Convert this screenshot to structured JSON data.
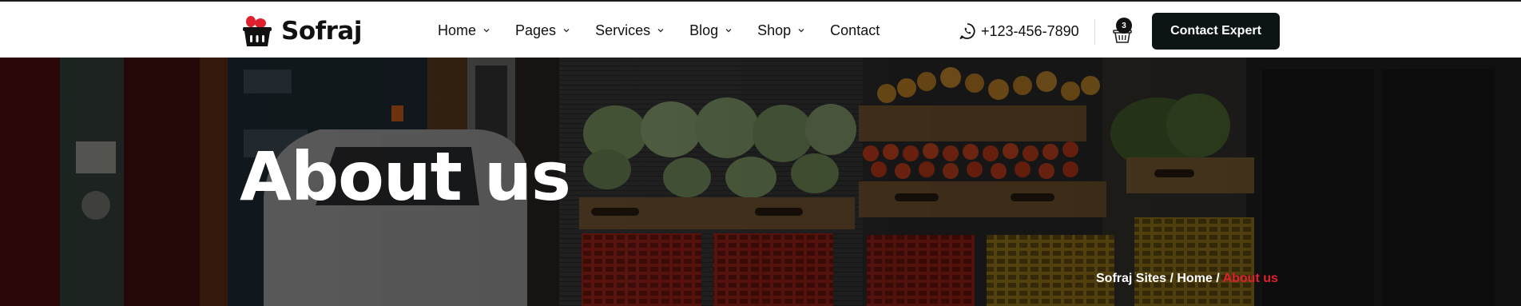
{
  "brand": {
    "name": "Sofraj",
    "accent": "#e0202f",
    "dark": "#0d1416"
  },
  "nav": {
    "items": [
      {
        "label": "Home",
        "icon": "chevron-down-icon"
      },
      {
        "label": "Pages",
        "icon": "chevron-down-icon"
      },
      {
        "label": "Services",
        "icon": "chevron-down-icon"
      },
      {
        "label": "Blog",
        "icon": "chevron-down-icon"
      },
      {
        "label": "Shop",
        "icon": "chevron-down-icon"
      },
      {
        "label": "Contact"
      }
    ]
  },
  "header": {
    "phone": "+123-456-7890",
    "phone_icon": "whatsapp-icon",
    "cart_icon": "basket-icon",
    "cart_count": "3",
    "cta_label": "Contact Expert"
  },
  "hero": {
    "title": "About us",
    "breadcrumb": {
      "site": "Sofraj Sites",
      "separator": " / ",
      "home": "Home",
      "current": "About us"
    }
  }
}
